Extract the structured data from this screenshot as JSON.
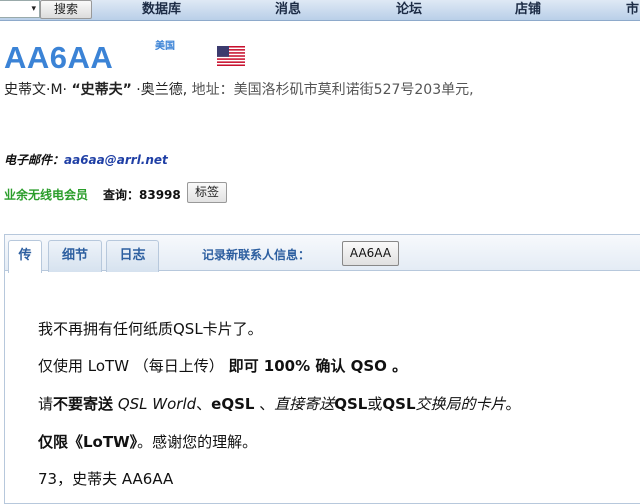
{
  "nav": {
    "dropdown_arrow": "▾",
    "search_label": "搜索",
    "items": [
      "数据库",
      "消息",
      "论坛",
      "店铺",
      "市"
    ]
  },
  "header": {
    "callsign": "AA6AA",
    "country": "美国",
    "flag_icon": "us-flag-icon",
    "name_pre": "史蒂文·M· ",
    "nickname": "“史蒂夫”",
    "name_post": " ·奥兰德, ",
    "address": "地址：美国洛杉矶市莫利诺街527号203单元,"
  },
  "contact": {
    "email_label": "电子邮件：",
    "email": "aa6aa@arrl.net",
    "membership": "业余无线电会员",
    "lookups": "查询：83998",
    "tag_label": "标签"
  },
  "tabs": {
    "items": [
      "传",
      "细节",
      "日志"
    ],
    "active": 0,
    "logger_label": "记录新联系人信息：",
    "logger_button": "AA6AA"
  },
  "bio": {
    "line1": "我不再拥有任何纸质QSL卡片了。",
    "line2_a": " 仅使用 LoTW （每日上传） ",
    "line2_b": "即可 100% 确认 QSO 。",
    "line3_a": "请",
    "line3_b": "不要寄送",
    "line3_c": " ",
    "line3_d": "QSL World",
    "line3_e": "、",
    "line3_f": "eQSL",
    "line3_g": " 、",
    "line3_h": "直接寄送",
    "line3_i": "QSL",
    "line3_j": "或",
    "line3_k": "QSL",
    "line3_l": "交换局的卡片",
    "line3_m": "。",
    "line4_a": "仅限《LoTW》",
    "line4_b": "。感谢您的理解。",
    "line5": "73，史蒂夫 AA6AA"
  },
  "colors": {
    "accent": "#3b83d6",
    "member_green": "#2a9d2a",
    "email_blue": "#1f3fa5"
  }
}
